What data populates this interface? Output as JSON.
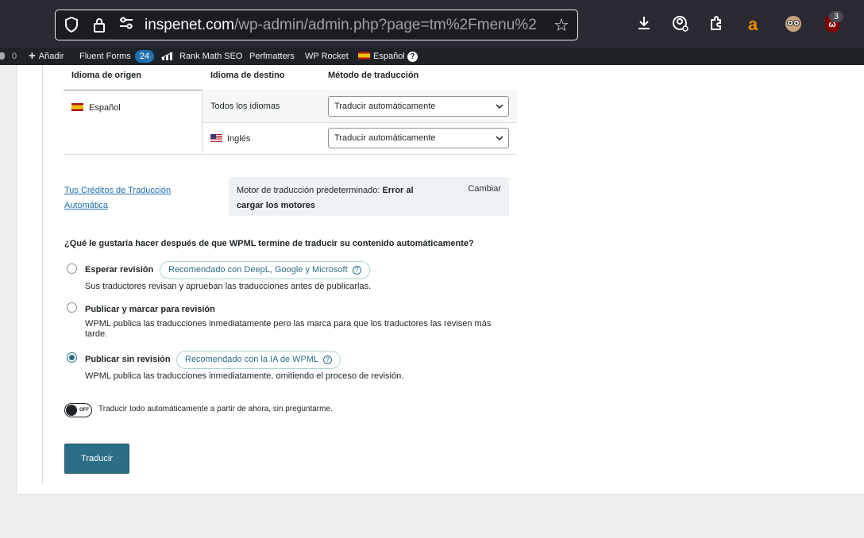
{
  "browser": {
    "url_host": "inspenet.com",
    "url_path": "/wp-admin/admin.php?page=tm%2Fmenu%2",
    "extension_badge": "3",
    "amazon_icon": "a",
    "ublock_icon": "ω"
  },
  "adminbar": {
    "comments_count": "0",
    "add_label": "Añadir",
    "fluent_forms_label": "Fluent Forms",
    "fluent_forms_count": "24",
    "rank_math_label": "Rank Math SEO",
    "perfmatters_label": "Perfmatters",
    "wp_rocket_label": "WP Rocket",
    "language_label": "Español",
    "help_icon": "?"
  },
  "table": {
    "headers": [
      "Idioma de origen",
      "Idioma de destino",
      "Método de traducción"
    ],
    "source_language": "Español",
    "rows": [
      {
        "target": "Todos los idiomas",
        "method": "Traducir automáticamente"
      },
      {
        "target": "Inglés",
        "method": "Traducir automáticamente"
      }
    ]
  },
  "credits_link": "Tus Créditos de Traducción Automática",
  "engine": {
    "prefix": "Motor de traducción predeterminado: ",
    "status": "Error al cargar los motores",
    "change_label": "Cambiar"
  },
  "question": "¿Qué le gustaría hacer después de que WPML termine de traducir su contenido automáticamente?",
  "options": [
    {
      "title": "Esperar revisión",
      "badge": "Recomendado con DeepL, Google y Microsoft",
      "desc": "Sus traductores revisan y aprueban las traducciones antes de publicarlas.",
      "selected": false
    },
    {
      "title": "Publicar y marcar para revisión",
      "badge": "",
      "desc": "WPML publica las traducciones inmediatamente pero las marca para que los traductores las revisen más tarde.",
      "selected": false
    },
    {
      "title": "Publicar sin revisión",
      "badge": "Recomendado con la IA de WPML",
      "desc": "WPML publica las traducciones inmediatamente, omitiendo el proceso de revisión.",
      "selected": true
    }
  ],
  "toggle": {
    "state_label": "OFF",
    "text": "Traducir todo automáticamente a partir de ahora, sin preguntarme."
  },
  "translate_button": "Traducir",
  "colors": {
    "accent": "#2c6e85",
    "link": "#2271b1",
    "adminbar": "#1d2327",
    "browser_chrome": "#2b2a33"
  }
}
